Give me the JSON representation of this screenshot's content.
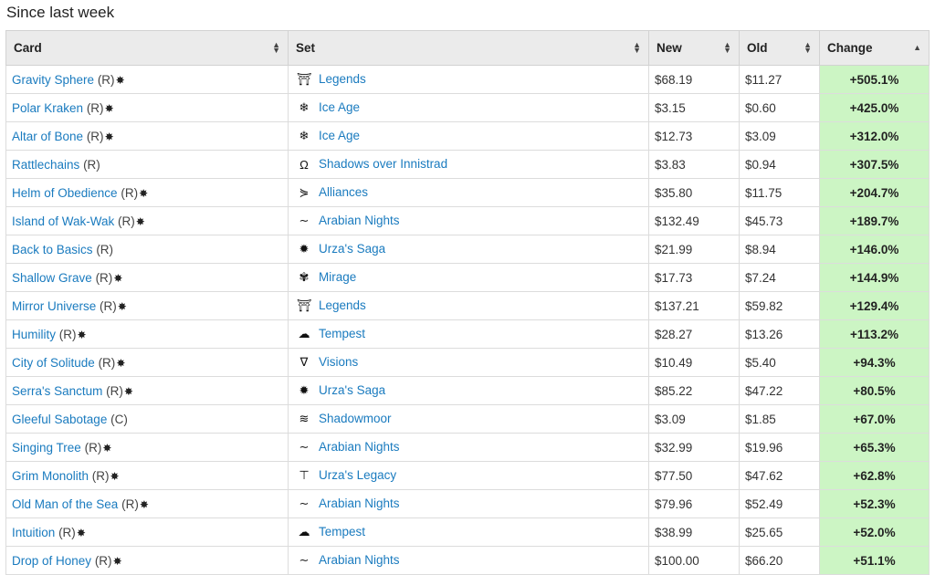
{
  "heading": "Since last week",
  "columns": {
    "card": "Card",
    "set": "Set",
    "new": "New",
    "old": "Old",
    "change": "Change"
  },
  "rows": [
    {
      "card": "Gravity Sphere",
      "rarity": "(R)",
      "foil": true,
      "set": "Legends",
      "set_icon": "legends-icon",
      "new": "$68.19",
      "old": "$11.27",
      "change": "+505.1%"
    },
    {
      "card": "Polar Kraken",
      "rarity": "(R)",
      "foil": true,
      "set": "Ice Age",
      "set_icon": "ice-age-icon",
      "new": "$3.15",
      "old": "$0.60",
      "change": "+425.0%"
    },
    {
      "card": "Altar of Bone",
      "rarity": "(R)",
      "foil": true,
      "set": "Ice Age",
      "set_icon": "ice-age-icon",
      "new": "$12.73",
      "old": "$3.09",
      "change": "+312.0%"
    },
    {
      "card": "Rattlechains",
      "rarity": "(R)",
      "foil": false,
      "set": "Shadows over Innistrad",
      "set_icon": "shadows-over-innistrad-icon",
      "new": "$3.83",
      "old": "$0.94",
      "change": "+307.5%"
    },
    {
      "card": "Helm of Obedience",
      "rarity": "(R)",
      "foil": true,
      "set": "Alliances",
      "set_icon": "alliances-icon",
      "new": "$35.80",
      "old": "$11.75",
      "change": "+204.7%"
    },
    {
      "card": "Island of Wak-Wak",
      "rarity": "(R)",
      "foil": true,
      "set": "Arabian Nights",
      "set_icon": "arabian-nights-icon",
      "new": "$132.49",
      "old": "$45.73",
      "change": "+189.7%"
    },
    {
      "card": "Back to Basics",
      "rarity": "(R)",
      "foil": false,
      "set": "Urza's Saga",
      "set_icon": "urzas-saga-icon",
      "new": "$21.99",
      "old": "$8.94",
      "change": "+146.0%"
    },
    {
      "card": "Shallow Grave",
      "rarity": "(R)",
      "foil": true,
      "set": "Mirage",
      "set_icon": "mirage-icon",
      "new": "$17.73",
      "old": "$7.24",
      "change": "+144.9%"
    },
    {
      "card": "Mirror Universe",
      "rarity": "(R)",
      "foil": true,
      "set": "Legends",
      "set_icon": "legends-icon",
      "new": "$137.21",
      "old": "$59.82",
      "change": "+129.4%"
    },
    {
      "card": "Humility",
      "rarity": "(R)",
      "foil": true,
      "set": "Tempest",
      "set_icon": "tempest-icon",
      "new": "$28.27",
      "old": "$13.26",
      "change": "+113.2%"
    },
    {
      "card": "City of Solitude",
      "rarity": "(R)",
      "foil": true,
      "set": "Visions",
      "set_icon": "visions-icon",
      "new": "$10.49",
      "old": "$5.40",
      "change": "+94.3%"
    },
    {
      "card": "Serra's Sanctum",
      "rarity": "(R)",
      "foil": true,
      "set": "Urza's Saga",
      "set_icon": "urzas-saga-icon",
      "new": "$85.22",
      "old": "$47.22",
      "change": "+80.5%"
    },
    {
      "card": "Gleeful Sabotage",
      "rarity": "(C)",
      "foil": false,
      "set": "Shadowmoor",
      "set_icon": "shadowmoor-icon",
      "new": "$3.09",
      "old": "$1.85",
      "change": "+67.0%"
    },
    {
      "card": "Singing Tree",
      "rarity": "(R)",
      "foil": true,
      "set": "Arabian Nights",
      "set_icon": "arabian-nights-icon",
      "new": "$32.99",
      "old": "$19.96",
      "change": "+65.3%"
    },
    {
      "card": "Grim Monolith",
      "rarity": "(R)",
      "foil": true,
      "set": "Urza's Legacy",
      "set_icon": "urzas-legacy-icon",
      "new": "$77.50",
      "old": "$47.62",
      "change": "+62.8%"
    },
    {
      "card": "Old Man of the Sea",
      "rarity": "(R)",
      "foil": true,
      "set": "Arabian Nights",
      "set_icon": "arabian-nights-icon",
      "new": "$79.96",
      "old": "$52.49",
      "change": "+52.3%"
    },
    {
      "card": "Intuition",
      "rarity": "(R)",
      "foil": true,
      "set": "Tempest",
      "set_icon": "tempest-icon",
      "new": "$38.99",
      "old": "$25.65",
      "change": "+52.0%"
    },
    {
      "card": "Drop of Honey",
      "rarity": "(R)",
      "foil": true,
      "set": "Arabian Nights",
      "set_icon": "arabian-nights-icon",
      "new": "$100.00",
      "old": "$66.20",
      "change": "+51.1%"
    }
  ],
  "colors": {
    "link": "#1a7bbf",
    "change_bg": "#ccf5c4",
    "header_bg": "#ebebeb"
  }
}
